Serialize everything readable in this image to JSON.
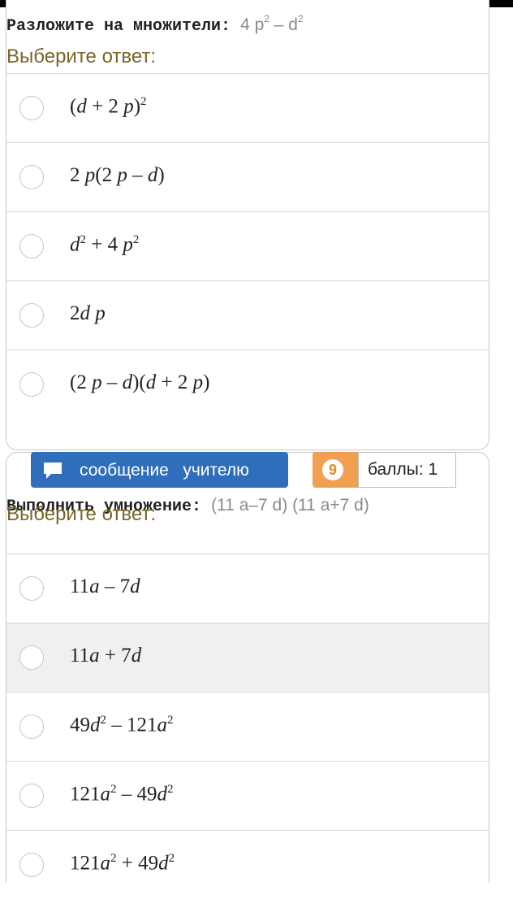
{
  "question1": {
    "text": "Разложите на множители:",
    "expr_base1": "4 p",
    "expr_exp1": "2",
    "expr_mid": " – d",
    "expr_exp2": "2",
    "prompt": "Выберите ответ:",
    "options": [
      {
        "p1": "(",
        "v1": "d",
        "p2": " + 2 ",
        "v2": "p",
        "p3": ")",
        "sup": "2"
      },
      {
        "p1": "2 ",
        "v1": "p",
        "p2": "(2 ",
        "v2": "p",
        "p3": " – ",
        "v3": "d",
        "p4": ")"
      },
      {
        "v1": "d",
        "sup1": "2",
        "p1": " + 4 ",
        "v2": "p",
        "sup2": "2"
      },
      {
        "p1": "2",
        "v1": "d",
        "p2": " ",
        "v2": "p"
      },
      {
        "p1": "(2 ",
        "v1": "p",
        "p2": " – ",
        "v2": "d",
        "p3": ")(",
        "v3": "d",
        "p4": " + 2 ",
        "v4": "p",
        "p5": ")"
      }
    ]
  },
  "message_button": {
    "label": "сообщение   учителю",
    "icon": "speech-bubble-icon"
  },
  "score_badge": {
    "number": "9",
    "label": "баллы: 1",
    "color": "#f0a050"
  },
  "question2": {
    "text": "Выполнить умножение:",
    "expr": "(11 a–7 d) (11 a+7 d)",
    "prompt": "Выберите ответ:",
    "options": [
      {
        "p1": "11",
        "v1": "a",
        "p2": " – 7",
        "v2": "d"
      },
      {
        "p1": "11",
        "v1": "a",
        "p2": " + 7",
        "v2": "d"
      },
      {
        "p1": "49",
        "v1": "d",
        "sup1": "2",
        "p2": " – 121",
        "v2": "a",
        "sup2": "2"
      },
      {
        "p1": "121",
        "v1": "a",
        "sup1": "2",
        "p2": " – 49",
        "v2": "d",
        "sup2": "2"
      },
      {
        "p1": "121",
        "v1": "a",
        "sup1": "2",
        "p2": " + 49",
        "v2": "d",
        "sup2": "2"
      }
    ]
  },
  "colors": {
    "accent_button": "#2f6eba",
    "prompt_text": "#7a6428",
    "highlight_row": "#f0f0f0"
  }
}
